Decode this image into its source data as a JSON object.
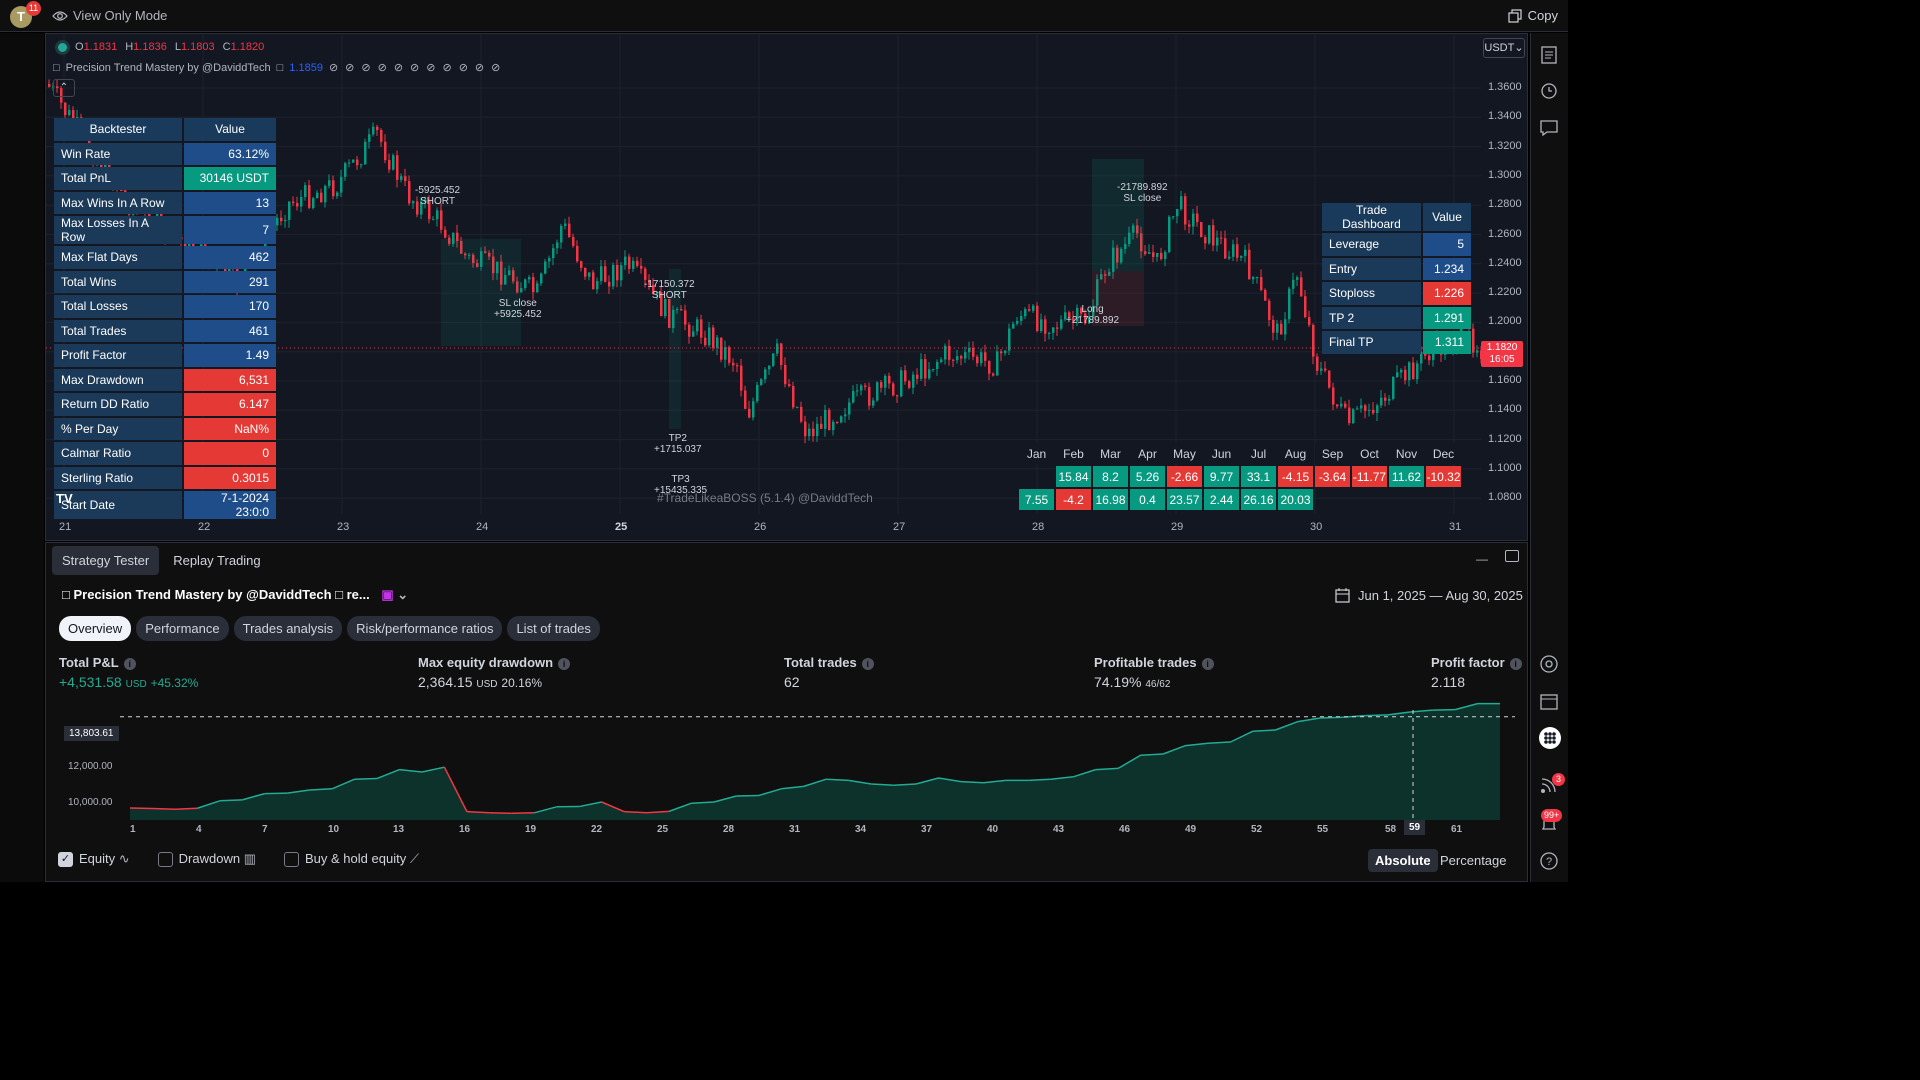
{
  "topbar": {
    "avatar_letter": "T",
    "avatar_badge": "11",
    "view_mode": "View Only Mode",
    "copy_label": "Copy"
  },
  "chart": {
    "ohlc": {
      "o_label": "O",
      "o": "1.1831",
      "h_label": "H",
      "h": "1.1836",
      "l_label": "L",
      "l": "1.1803",
      "c_label": "C",
      "c": "1.1820"
    },
    "indicator": {
      "name": "Precision Trend Mastery by @DaviddTech",
      "value": "1.1859"
    },
    "currency": "USDT",
    "price_tag": {
      "price": "1.1820",
      "time": "16:05"
    },
    "y_axis": [
      "1.3600",
      "1.3400",
      "1.3200",
      "1.3000",
      "1.2800",
      "1.2600",
      "1.2400",
      "1.2200",
      "1.2000",
      "1.1800",
      "1.1600",
      "1.1400",
      "1.1200",
      "1.1000",
      "1.0800"
    ],
    "x_axis": [
      "21",
      "22",
      "23",
      "24",
      "25",
      "26",
      "27",
      "28",
      "29",
      "30",
      "31"
    ],
    "watermark": "#TradeLikeaBOSS (5.1.4) @DaviddTech",
    "annotations": {
      "a1": "-5925.452",
      "a1b": "SHORT",
      "a2": "SL close",
      "a2b": "+5925.452",
      "a3": "-17150.372",
      "a3b": "SHORT",
      "a4": "TP2",
      "a4b": "+1715.037",
      "a5": "TP3",
      "a5b": "+15435.335",
      "a6": "-21789.892",
      "a6b": "SL close",
      "a7": "Long",
      "a7b": "+21789.892"
    }
  },
  "backtester": {
    "header": [
      "Backtester",
      "Value"
    ],
    "rows": [
      {
        "label": "Win Rate",
        "value": "63.12%",
        "color": "blue"
      },
      {
        "label": "Total PnL",
        "value": "30146 USDT",
        "color": "green"
      },
      {
        "label": "Max Wins In A Row",
        "value": "13",
        "color": "blue"
      },
      {
        "label": "Max Losses In A Row",
        "value": "7",
        "color": "blue"
      },
      {
        "label": "Max Flat Days",
        "value": "462",
        "color": "blue"
      },
      {
        "label": "Total Wins",
        "value": "291",
        "color": "blue"
      },
      {
        "label": "Total Losses",
        "value": "170",
        "color": "blue"
      },
      {
        "label": "Total Trades",
        "value": "461",
        "color": "blue"
      },
      {
        "label": "Profit Factor",
        "value": "1.49",
        "color": "blue"
      },
      {
        "label": "Max Drawdown",
        "value": "6,531",
        "color": "red"
      },
      {
        "label": "Return DD Ratio",
        "value": "6.147",
        "color": "red"
      },
      {
        "label": "% Per Day",
        "value": "NaN%",
        "color": "red"
      },
      {
        "label": "Calmar Ratio",
        "value": "0",
        "color": "red"
      },
      {
        "label": "Sterling Ratio",
        "value": "0.3015",
        "color": "red"
      },
      {
        "label": "Start Date",
        "value": "7-1-2024 23:0:0",
        "color": "blue"
      }
    ]
  },
  "trade_dashboard": {
    "header": [
      "Trade Dashboard",
      "Value"
    ],
    "rows": [
      {
        "label": "Leverage",
        "value": "5",
        "color": "blue"
      },
      {
        "label": "Entry",
        "value": "1.234",
        "color": "blue"
      },
      {
        "label": "Stoploss",
        "value": "1.226",
        "color": "red"
      },
      {
        "label": "TP 2",
        "value": "1.291",
        "color": "green"
      },
      {
        "label": "Final TP",
        "value": "1.311",
        "color": "green"
      }
    ]
  },
  "monthly": {
    "months": [
      "Jan",
      "Feb",
      "Mar",
      "Apr",
      "May",
      "Jun",
      "Jul",
      "Aug",
      "Sep",
      "Oct",
      "Nov",
      "Dec"
    ],
    "row1": [
      "",
      "15.84",
      "8.2",
      "5.26",
      "-2.66",
      "9.77",
      "33.1",
      "-4.15",
      "-3.64",
      "-11.77",
      "11.62",
      "-10.32"
    ],
    "row2": [
      "7.55",
      "-4.2",
      "16.98",
      "0.4",
      "23.57",
      "2.44",
      "26.16",
      "20.03",
      "",
      "",
      "",
      ""
    ]
  },
  "bottom": {
    "tabs": [
      "Strategy Tester",
      "Replay Trading"
    ],
    "strategy_name": "Precision Trend Mastery by @DaviddTech",
    "strategy_suffix": "re...",
    "date_range": "Jun 1, 2025 — Aug 30, 2025",
    "subtabs": [
      "Overview",
      "Performance",
      "Trades analysis",
      "Risk/performance ratios",
      "List of trades"
    ],
    "metrics": {
      "total_pnl": {
        "label": "Total P&L",
        "value": "+4,531.58",
        "unit": "USD",
        "pct": "+45.32%"
      },
      "max_dd": {
        "label": "Max equity drawdown",
        "value": "2,364.15",
        "unit": "USD",
        "pct": "20.16%"
      },
      "total_trades": {
        "label": "Total trades",
        "value": "62"
      },
      "profitable": {
        "label": "Profitable trades",
        "value": "74.19%",
        "sub": "46/62"
      },
      "profit_factor": {
        "label": "Profit factor",
        "value": "2.118"
      }
    },
    "equity_y": [
      "13,803.61",
      "12,000.00",
      "10,000.00"
    ],
    "equity_x": [
      "1",
      "4",
      "7",
      "10",
      "13",
      "16",
      "19",
      "22",
      "25",
      "28",
      "31",
      "34",
      "37",
      "40",
      "43",
      "46",
      "49",
      "52",
      "55",
      "58",
      "59",
      "61"
    ],
    "equity_values": [
      10000,
      9980,
      9950,
      9990,
      10300,
      10340,
      10600,
      10620,
      10750,
      10800,
      11200,
      11230,
      11600,
      11500,
      11700,
      9850,
      9800,
      9780,
      9800,
      10050,
      10060,
      10250,
      9850,
      9800,
      9860,
      10200,
      10250,
      10500,
      10520,
      10800,
      10900,
      11200,
      11150,
      11000,
      10950,
      11000,
      11250,
      11100,
      11050,
      11150,
      11150,
      11200,
      11300,
      11600,
      11650,
      12200,
      12250,
      12600,
      12700,
      12750,
      13200,
      13250,
      13600,
      13750,
      13780,
      13850,
      13880,
      14000,
      14080,
      14100,
      14350,
      14350
    ],
    "legend": [
      "Equity",
      "Drawdown",
      "Buy & hold equity"
    ],
    "mode_absolute": "Absolute",
    "mode_percentage": "Percentage"
  },
  "rightbar": {
    "badge_3": "3",
    "badge_99": "99+"
  }
}
